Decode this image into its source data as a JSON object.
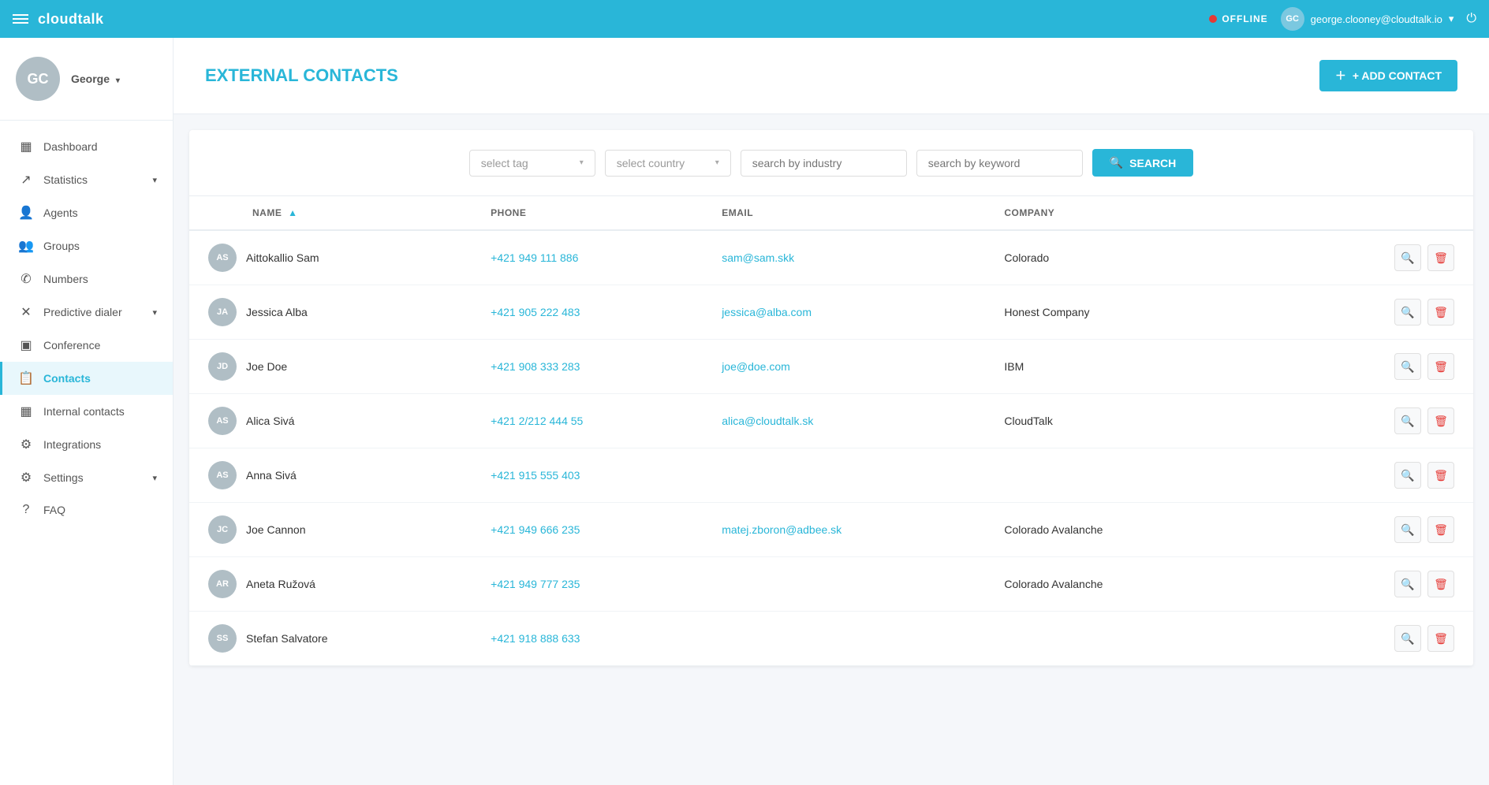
{
  "navbar": {
    "brand": "cloudtalk",
    "hamburger_label": "menu",
    "status": "OFFLINE",
    "user_email": "george.clooney@cloudtalk.io",
    "user_initials": "GC"
  },
  "sidebar": {
    "user_initials": "GC",
    "user_name": "George",
    "nav_items": [
      {
        "id": "dashboard",
        "label": "Dashboard",
        "icon": "▦",
        "has_caret": false
      },
      {
        "id": "statistics",
        "label": "Statistics",
        "icon": "↗",
        "has_caret": true
      },
      {
        "id": "agents",
        "label": "Agents",
        "icon": "👤",
        "has_caret": false
      },
      {
        "id": "groups",
        "label": "Groups",
        "icon": "👥",
        "has_caret": false
      },
      {
        "id": "numbers",
        "label": "Numbers",
        "icon": "✆",
        "has_caret": false
      },
      {
        "id": "predictive-dialer",
        "label": "Predictive dialer",
        "icon": "✕",
        "has_caret": true
      },
      {
        "id": "conference",
        "label": "Conference",
        "icon": "▣",
        "has_caret": false
      },
      {
        "id": "contacts",
        "label": "Contacts",
        "icon": "📋",
        "has_caret": false,
        "active": true
      },
      {
        "id": "internal-contacts",
        "label": "Internal contacts",
        "icon": "▦",
        "has_caret": false
      },
      {
        "id": "integrations",
        "label": "Integrations",
        "icon": "⚙",
        "has_caret": false
      },
      {
        "id": "settings",
        "label": "Settings",
        "icon": "⚙",
        "has_caret": true
      },
      {
        "id": "faq",
        "label": "FAQ",
        "icon": "?",
        "has_caret": false
      }
    ]
  },
  "page": {
    "title": "EXTERNAL CONTACTS",
    "add_contact_label": "+ ADD CONTACT"
  },
  "filters": {
    "select_tag_placeholder": "select tag",
    "select_country_placeholder": "select country",
    "search_industry_placeholder": "search by industry",
    "search_keyword_placeholder": "search by keyword",
    "search_button_label": "SEARCH"
  },
  "table": {
    "columns": [
      {
        "id": "name",
        "label": "NAME",
        "sort": true
      },
      {
        "id": "phone",
        "label": "PHONE",
        "sort": false
      },
      {
        "id": "email",
        "label": "EMAIL",
        "sort": false
      },
      {
        "id": "company",
        "label": "COMPANY",
        "sort": false
      }
    ],
    "rows": [
      {
        "initials": "AS",
        "name": "Aittokallio Sam",
        "phone": "+421 949 111 886",
        "email": "sam@sam.skk",
        "company": "Colorado"
      },
      {
        "initials": "JA",
        "name": "Jessica Alba",
        "phone": "+421 905 222 483",
        "email": "jessica@alba.com",
        "company": "Honest Company"
      },
      {
        "initials": "JD",
        "name": "Joe Doe",
        "phone": "+421 908 333 283",
        "email": "joe@doe.com",
        "company": "IBM"
      },
      {
        "initials": "AS",
        "name": "Alica Sivá",
        "phone": "+421 2/212 444 55",
        "email": "alica@cloudtalk.sk",
        "company": "CloudTalk"
      },
      {
        "initials": "AS",
        "name": "Anna Sivá",
        "phone": "+421 915 555 403",
        "email": "",
        "company": ""
      },
      {
        "initials": "JC",
        "name": "Joe Cannon",
        "phone": "+421 949 666 235",
        "email": "matej.zboron@adbee.sk",
        "company": "Colorado Avalanche"
      },
      {
        "initials": "AR",
        "name": "Aneta Ružová",
        "phone": "+421 949 777 235",
        "email": "",
        "company": "Colorado Avalanche"
      },
      {
        "initials": "SS",
        "name": "Stefan Salvatore",
        "phone": "+421 918 888 633",
        "email": "",
        "company": ""
      }
    ]
  }
}
